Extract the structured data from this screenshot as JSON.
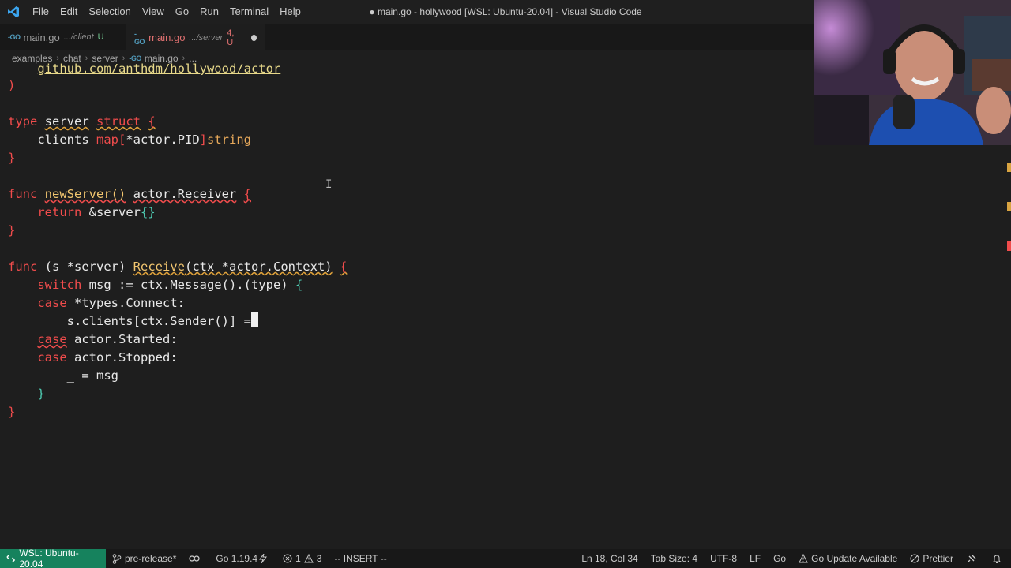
{
  "window": {
    "title": "● main.go - hollywood [WSL: Ubuntu-20.04] - Visual Studio Code"
  },
  "menu": [
    "File",
    "Edit",
    "Selection",
    "View",
    "Go",
    "Run",
    "Terminal",
    "Help"
  ],
  "tabs": [
    {
      "icon": "go-file-icon",
      "label": "main.go",
      "path": ".../client",
      "status": "U",
      "active": false
    },
    {
      "icon": "go-file-icon",
      "label": "main.go",
      "path": ".../server",
      "status": "4, U",
      "active": true,
      "dirty": true
    }
  ],
  "go_icon_text": "-GO",
  "breadcrumb": [
    "examples",
    "chat",
    "server",
    "main.go",
    "..."
  ],
  "code": {
    "import_line": "github.com/anthdm/hollywood/actor",
    "close_paren": ")",
    "type_kw": "type",
    "server_name": "server",
    "struct_kw": "struct",
    "open_brace": "{",
    "clients_field": "clients",
    "map_kw": "map",
    "lbracket": "[",
    "ptr_actor_pid": "*actor.PID",
    "rbracket": "]",
    "string_ty": "string",
    "close_brace": "}",
    "func_kw": "func",
    "new_server_fn": "newServer()",
    "actor_receiver": "actor.Receiver",
    "return_kw": "return",
    "amp_server": "&server",
    "empty_braces": "{}",
    "recv_sig_1": "(s *server)",
    "receive_fn": "Receive",
    "recv_args": "(ctx *actor.Context)",
    "switch_kw": "switch",
    "switch_expr": "msg := ctx.Message().",
    "type_assert": "(type)",
    "case_kw": "case",
    "case1": "*types.Connect:",
    "assign_line": "s.clients[ctx.Sender()] =",
    "case2": "actor.Started:",
    "case3": "actor.Stopped:",
    "blank_assign": "_ = msg",
    "inner_close": "}",
    "outer_close": "}"
  },
  "statusbar": {
    "remote": "WSL: Ubuntu-20.04",
    "branch": "pre-release*",
    "go_version": "Go 1.19.4",
    "errors": "1",
    "warnings": "3",
    "mode": "-- INSERT --",
    "position": "Ln 18, Col 34",
    "tab_size": "Tab Size: 4",
    "encoding": "UTF-8",
    "eol": "LF",
    "language": "Go",
    "go_update": "Go Update Available",
    "prettier": "Prettier"
  },
  "colors": {
    "remote_bg": "#16825d",
    "active_tab_text": "#e07070",
    "keyword": "#f14c4c",
    "function": "#f1c56f",
    "bracket": "#4ec9b0"
  }
}
